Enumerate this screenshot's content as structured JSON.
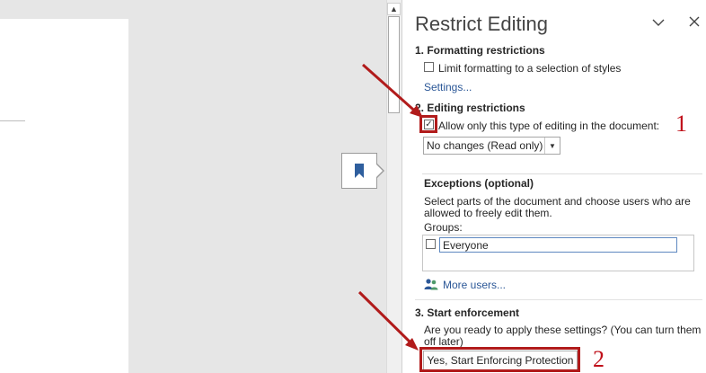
{
  "pane": {
    "title": "Restrict Editing",
    "collapse_icon": "chevron-down-icon",
    "close_icon": "close-icon"
  },
  "section1": {
    "heading": "1. Formatting restrictions",
    "checkbox_label": "Limit formatting to a selection of styles",
    "checkbox_checked": false,
    "settings_link": "Settings..."
  },
  "section2": {
    "heading": "2. Editing restrictions",
    "checkbox_label": "Allow only this type of editing in the document:",
    "checkbox_checked": true,
    "checkmark": "✓",
    "select_value": "No changes (Read only)",
    "select_arrow": "▼",
    "annotation_number": "1"
  },
  "exceptions": {
    "heading": "Exceptions (optional)",
    "description": "Select parts of the document and choose users who are allowed to freely edit them.",
    "groups_label": "Groups:",
    "groups": [
      {
        "label": "Everyone",
        "checked": false
      }
    ],
    "more_users_link": "More users...",
    "more_users_icon": "users-icon"
  },
  "section3": {
    "heading": "3. Start enforcement",
    "description": "Are you ready to apply these settings? (You can turn them off later)",
    "button_label": "Yes, Start Enforcing Protection",
    "annotation_number": "2"
  },
  "scrollbar": {
    "up_arrow": "▲"
  },
  "bookmark": {
    "icon": "bookmark-icon"
  },
  "colors": {
    "annotation_red": "#c0101a",
    "link_blue": "#2b5797",
    "bookmark_blue": "#2f5f9e"
  }
}
